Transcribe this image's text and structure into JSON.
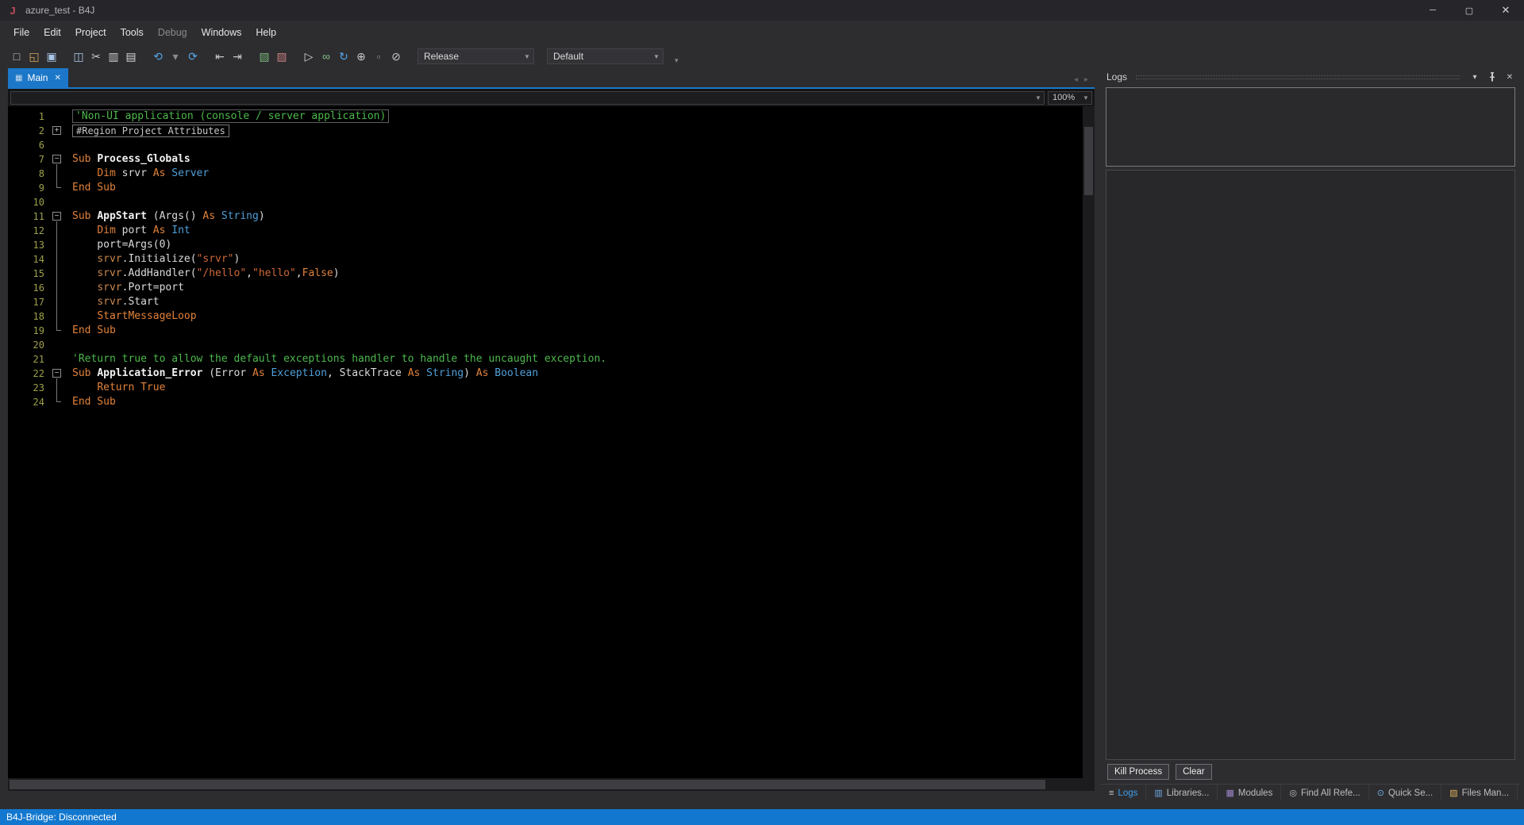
{
  "window": {
    "logo_letter": "J",
    "title": "azure_test - B4J",
    "status_text": "B4J-Bridge: Disconnected",
    "controls": {
      "minimize": "─",
      "maximize": "▢",
      "close": "✕"
    }
  },
  "menu": {
    "items": [
      {
        "label": "File"
      },
      {
        "label": "Edit"
      },
      {
        "label": "Project"
      },
      {
        "label": "Tools"
      },
      {
        "label": "Debug",
        "dimmed": true
      },
      {
        "label": "Windows"
      },
      {
        "label": "Help"
      }
    ]
  },
  "toolbar": {
    "build_config": "Release",
    "run_config": "Default",
    "overflow_glyph": "▾",
    "icons": [
      {
        "name": "new-file-icon",
        "glyph": "□",
        "color": "#C9C9C9"
      },
      {
        "name": "open-project-icon",
        "glyph": "◱",
        "color": "#D9A85C"
      },
      {
        "name": "save-icon",
        "glyph": "▣",
        "color": "#A9C7E7"
      },
      {
        "name": "save-all-icon",
        "glyph": "◫",
        "color": "#A9C7E7",
        "gap": true
      },
      {
        "name": "cut-icon",
        "glyph": "✂",
        "color": "#C9C9C9"
      },
      {
        "name": "copy-icon",
        "glyph": "▥",
        "color": "#C9C9C9"
      },
      {
        "name": "paste-icon",
        "glyph": "▤",
        "color": "#D9D9D9"
      },
      {
        "name": "undo-icon",
        "glyph": "⟲",
        "color": "#55A6E8",
        "gap": true
      },
      {
        "name": "undo-history-caret-icon",
        "glyph": "▾",
        "color": "#8A8A8E"
      },
      {
        "name": "redo-icon",
        "glyph": "⟳",
        "color": "#55A6E8"
      },
      {
        "name": "previous-sub-icon",
        "glyph": "⇤",
        "color": "#C9C9C9",
        "gap": true
      },
      {
        "name": "next-sub-icon",
        "glyph": "⇥",
        "color": "#C9C9C9"
      },
      {
        "name": "comment-icon",
        "glyph": "▧",
        "color": "#76B376",
        "gap": true
      },
      {
        "name": "uncomment-icon",
        "glyph": "▨",
        "color": "#C57E7E"
      },
      {
        "name": "run-icon",
        "glyph": "▷",
        "color": "#D9D9D9",
        "gap": true
      },
      {
        "name": "connect-icon",
        "glyph": "∞",
        "color": "#86BF86"
      },
      {
        "name": "sync-icon",
        "glyph": "↻",
        "color": "#55A6E8"
      },
      {
        "name": "designer-icon",
        "glyph": "⊕",
        "color": "#C9C9C9"
      },
      {
        "name": "stop-icon",
        "glyph": "▫",
        "color": "#8A8A8E"
      },
      {
        "name": "breakpoints-icon",
        "glyph": "⊘",
        "color": "#C9C9C9"
      }
    ]
  },
  "tabs": {
    "nav_left": "◂",
    "nav_right": "▸",
    "items": [
      {
        "label": "Main",
        "icon_glyph": "▦",
        "close_glyph": "✕",
        "active": true
      }
    ]
  },
  "editor": {
    "zoom": "100%",
    "lines": [
      {
        "n": 1,
        "fold": "",
        "boxed": true,
        "tokens": [
          [
            "c",
            "'Non-UI application (console / server application)"
          ]
        ]
      },
      {
        "n": 2,
        "fold": "expand",
        "tokens": [
          [
            "r",
            "#Region Project Attributes"
          ]
        ]
      },
      {
        "n": 6,
        "fold": "",
        "tokens": []
      },
      {
        "n": 7,
        "fold": "collapse",
        "tokens": [
          [
            "k",
            "Sub"
          ],
          [
            "p",
            " "
          ],
          [
            "n",
            "Process_Globals"
          ]
        ]
      },
      {
        "n": 8,
        "fold": "line",
        "tokens": [
          [
            "p",
            "    "
          ],
          [
            "k",
            "Dim"
          ],
          [
            "p",
            " srvr "
          ],
          [
            "k",
            "As"
          ],
          [
            "t",
            " Server"
          ]
        ]
      },
      {
        "n": 9,
        "fold": "corner",
        "tokens": [
          [
            "k",
            "End Sub"
          ]
        ]
      },
      {
        "n": 10,
        "fold": "",
        "tokens": []
      },
      {
        "n": 11,
        "fold": "collapse",
        "tokens": [
          [
            "k",
            "Sub"
          ],
          [
            "p",
            " "
          ],
          [
            "n",
            "AppStart"
          ],
          [
            "p",
            " (Args() "
          ],
          [
            "k",
            "As"
          ],
          [
            "t",
            " String"
          ],
          [
            "p",
            ")"
          ]
        ]
      },
      {
        "n": 12,
        "fold": "line",
        "tokens": [
          [
            "p",
            "    "
          ],
          [
            "k",
            "Dim"
          ],
          [
            "p",
            " port "
          ],
          [
            "k",
            "As"
          ],
          [
            "t",
            " Int"
          ]
        ]
      },
      {
        "n": 13,
        "fold": "line",
        "tokens": [
          [
            "p",
            "    port=Args(0)"
          ]
        ]
      },
      {
        "n": 14,
        "fold": "line",
        "tokens": [
          [
            "p",
            "    "
          ],
          [
            "v",
            "srvr"
          ],
          [
            "p",
            ".Initialize("
          ],
          [
            "s",
            "\"srvr\""
          ],
          [
            "p",
            ")"
          ]
        ]
      },
      {
        "n": 15,
        "fold": "line",
        "tokens": [
          [
            "p",
            "    "
          ],
          [
            "v",
            "srvr"
          ],
          [
            "p",
            ".AddHandler("
          ],
          [
            "s",
            "\"/hello\""
          ],
          [
            "p",
            ","
          ],
          [
            "s",
            "\"hello\""
          ],
          [
            "p",
            ","
          ],
          [
            "k",
            "False"
          ],
          [
            "p",
            ")"
          ]
        ]
      },
      {
        "n": 16,
        "fold": "line",
        "tokens": [
          [
            "p",
            "    "
          ],
          [
            "v",
            "srvr"
          ],
          [
            "p",
            ".Port=port"
          ]
        ]
      },
      {
        "n": 17,
        "fold": "line",
        "tokens": [
          [
            "p",
            "    "
          ],
          [
            "v",
            "srvr"
          ],
          [
            "p",
            ".Start"
          ]
        ]
      },
      {
        "n": 18,
        "fold": "line",
        "tokens": [
          [
            "p",
            "    "
          ],
          [
            "k",
            "StartMessageLoop"
          ]
        ]
      },
      {
        "n": 19,
        "fold": "corner",
        "tokens": [
          [
            "k",
            "End Sub"
          ]
        ]
      },
      {
        "n": 20,
        "fold": "",
        "tokens": []
      },
      {
        "n": 21,
        "fold": "",
        "tokens": [
          [
            "c",
            "'Return true to allow the default exceptions handler to handle the uncaught exception."
          ]
        ]
      },
      {
        "n": 22,
        "fold": "collapse",
        "tokens": [
          [
            "k",
            "Sub"
          ],
          [
            "p",
            " "
          ],
          [
            "n",
            "Application_Error"
          ],
          [
            "p",
            " (Error "
          ],
          [
            "k",
            "As"
          ],
          [
            "t",
            " Exception"
          ],
          [
            "p",
            ", StackTrace "
          ],
          [
            "k",
            "As"
          ],
          [
            "t",
            " String"
          ],
          [
            "p",
            ") "
          ],
          [
            "k",
            "As"
          ],
          [
            "t",
            " Boolean"
          ]
        ]
      },
      {
        "n": 23,
        "fold": "line",
        "tokens": [
          [
            "p",
            "    "
          ],
          [
            "k",
            "Return True"
          ]
        ]
      },
      {
        "n": 24,
        "fold": "corner",
        "tokens": [
          [
            "k",
            "End Sub"
          ]
        ]
      }
    ]
  },
  "logs_panel": {
    "title": "Logs",
    "header_icons": {
      "menu": "▾",
      "close": "✕"
    },
    "buttons": [
      {
        "label": "Kill Process"
      },
      {
        "label": "Clear"
      }
    ],
    "tabs": [
      {
        "label": "Logs",
        "glyph": "≡",
        "color": "#C9C9C9",
        "active": true
      },
      {
        "label": "Libraries...",
        "glyph": "▥",
        "color": "#6FA8E0"
      },
      {
        "label": "Modules",
        "glyph": "▦",
        "color": "#9F86C8"
      },
      {
        "label": "Find All Refe...",
        "glyph": "◎",
        "color": "#BFBFBF"
      },
      {
        "label": "Quick Se...",
        "glyph": "⊙",
        "color": "#6FAFE0"
      },
      {
        "label": "Files Man...",
        "glyph": "▨",
        "color": "#D9B05C"
      }
    ]
  }
}
